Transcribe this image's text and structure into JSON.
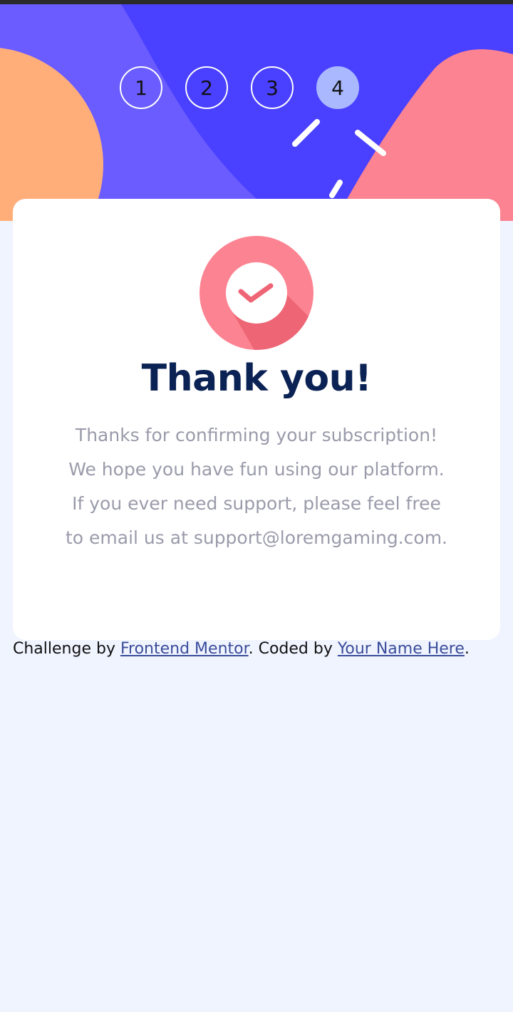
{
  "stepper": {
    "steps": [
      {
        "label": "1",
        "active": false
      },
      {
        "label": "2",
        "active": false
      },
      {
        "label": "3",
        "active": false
      },
      {
        "label": "4",
        "active": true
      }
    ]
  },
  "card": {
    "icon": "check-circle-icon",
    "title": "Thank you!",
    "message_lines": [
      "Thanks for confirming your subscription!",
      "We hope you have fun using our platform.",
      "If you ever need support, please feel free",
      "to email us at support@loremgaming.com."
    ]
  },
  "attribution": {
    "prefix": "Challenge by ",
    "link1": "Frontend Mentor",
    "middle": ". Coded by ",
    "link2": "Your Name Here",
    "suffix": "."
  },
  "colors": {
    "hero_bg": "#4A40FF",
    "hero_accent": "#6A5CFF",
    "orange_blob": "#FFAE7A",
    "pink_blob": "#FC8391",
    "step_active": "#A9B8FF",
    "title": "#0B2254",
    "message": "#9A9BAA",
    "page_bg": "#F0F4FF",
    "link": "#3A4C9A"
  }
}
